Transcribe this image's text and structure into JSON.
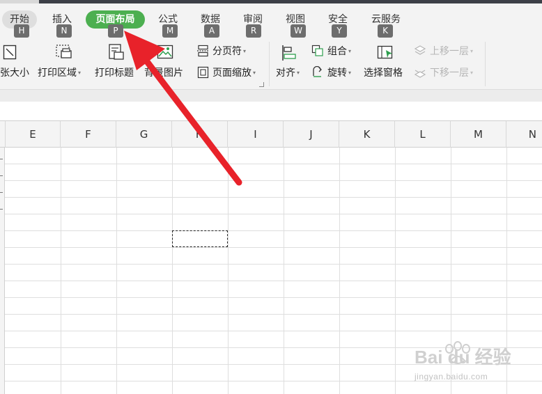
{
  "menu": {
    "tabs": [
      {
        "label": "开始",
        "key": "H"
      },
      {
        "label": "插入",
        "key": "N"
      },
      {
        "label": "页面布局",
        "key": "P"
      },
      {
        "label": "公式",
        "key": "M"
      },
      {
        "label": "数据",
        "key": "A"
      },
      {
        "label": "审阅",
        "key": "R"
      },
      {
        "label": "视图",
        "key": "W"
      },
      {
        "label": "安全",
        "key": "Y"
      },
      {
        "label": "云服务",
        "key": "K"
      }
    ],
    "active_tab": "页面布局"
  },
  "ribbon": {
    "paper_size": "张大小",
    "print_area": "打印区域",
    "print_titles": "打印标题",
    "background_image": "背景图片",
    "page_break": "分页符",
    "page_zoom": "页面缩放",
    "align": "对齐",
    "group": "组合",
    "rotate": "旋转",
    "selection_pane": "选择窗格",
    "bring_forward": "上移一层",
    "send_backward": "下移一层"
  },
  "grid": {
    "columns": [
      "E",
      "F",
      "G",
      "H",
      "I",
      "J",
      "K",
      "L",
      "M",
      "N"
    ]
  },
  "watermark": {
    "logo_text": "Bai du 经验",
    "url": "jingyan.baidu.com"
  },
  "colors": {
    "active_tab": "#4caf50",
    "arrow": "#e8222a",
    "key_badge": "#6d6d6d"
  }
}
